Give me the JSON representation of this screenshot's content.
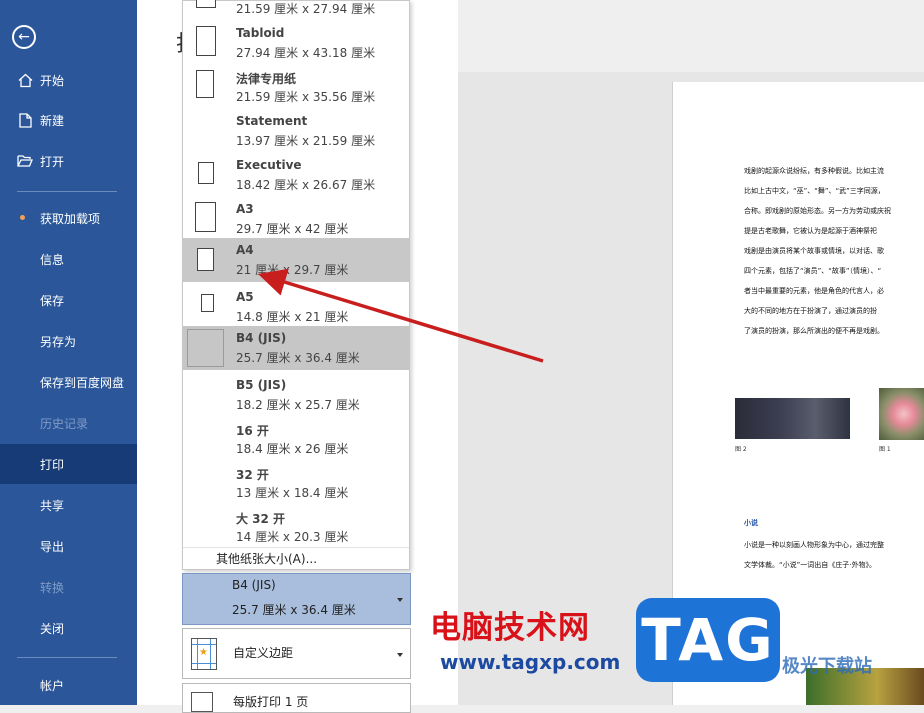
{
  "sidebar": {
    "back_icon": "arrow-left-icon",
    "items": [
      {
        "label": "开始",
        "icon": "home-icon"
      },
      {
        "label": "新建",
        "icon": "new-file-icon"
      },
      {
        "label": "打开",
        "icon": "folder-open-icon"
      },
      {
        "label": "获取加载项"
      },
      {
        "label": "信息"
      },
      {
        "label": "保存"
      },
      {
        "label": "另存为"
      },
      {
        "label": "保存到百度网盘"
      },
      {
        "label": "历史记录",
        "disabled": true
      },
      {
        "label": "打印",
        "active": true
      },
      {
        "label": "共享"
      },
      {
        "label": "导出"
      },
      {
        "label": "转换",
        "disabled": true
      },
      {
        "label": "关闭"
      },
      {
        "label": "帐户"
      }
    ]
  },
  "heading_fragment": "打",
  "paper_sizes": {
    "items": [
      {
        "name": "",
        "dims": "21.59 厘米 x 27.94 厘米"
      },
      {
        "name": "Tabloid",
        "dims": "27.94 厘米 x 43.18 厘米"
      },
      {
        "name": "法律专用纸",
        "dims": "21.59 厘米 x 35.56 厘米"
      },
      {
        "name": "Statement",
        "dims": "13.97 厘米 x 21.59 厘米"
      },
      {
        "name": "Executive",
        "dims": "18.42 厘米 x 26.67 厘米"
      },
      {
        "name": "A3",
        "dims": "29.7 厘米 x 42 厘米"
      },
      {
        "name": "A4",
        "dims": "21 厘米 x 29.7 厘米",
        "state": "hover"
      },
      {
        "name": "A5",
        "dims": "14.8 厘米 x 21 厘米"
      },
      {
        "name": "B4 (JIS)",
        "dims": "25.7 厘米 x 36.4 厘米",
        "state": "selected"
      },
      {
        "name": "B5 (JIS)",
        "dims": "18.2 厘米 x 25.7 厘米"
      },
      {
        "name": "16 开",
        "dims": "18.4 厘米 x 26 厘米"
      },
      {
        "name": "32 开",
        "dims": "13 厘米 x 18.4 厘米"
      },
      {
        "name": "大 32 开",
        "dims": "14 厘米 x 20.3 厘米"
      }
    ],
    "more_label": "其他纸张大小(A)..."
  },
  "paper_select": {
    "name": "B4 (JIS)",
    "dims": "25.7 厘米 x 36.4 厘米"
  },
  "margins_select": {
    "label": "自定义边距"
  },
  "pages_per_sheet": {
    "label": "每版打印 1 页"
  },
  "document_preview": {
    "lines": [
      "戏剧的起源众说纷纭，有多种假说。比如主流",
      "比如上古中文，“巫”、“舞”、“武”三字同源，",
      "合称。即戏剧的原始形态。另一方为劳动或庆祝",
      "提是古老歌舞，它被认为是起源于酒神祭祀",
      "戏剧是由演员将某个故事或情境，以对话、歌",
      "四个元素，包括了“演员”、“故事”（情境）、“",
      "者当中最重要的元素，他是角色的代言人，必",
      "大的不同的地方在于扮演了，通过演员的扮",
      "了演员的扮演，那么所演出的便不再是戏剧。"
    ],
    "caption_1": "图 2",
    "caption_2": "图 1",
    "section_heading": "小说",
    "section_lines": [
      "小说是一种以刻画人物形象为中心，通过完整",
      "文学体裁。“小说”一词出自《庄子·外物》。"
    ]
  },
  "watermark": {
    "text": "电脑技术网",
    "url": "www.tagxp.com",
    "badge": "TAG",
    "site": "极光下载站"
  },
  "colors": {
    "sidebar": "#2b579a",
    "sidebar_active": "#163b76",
    "selected_paper": "#a8bedc",
    "arrow": "#c81e1e"
  }
}
